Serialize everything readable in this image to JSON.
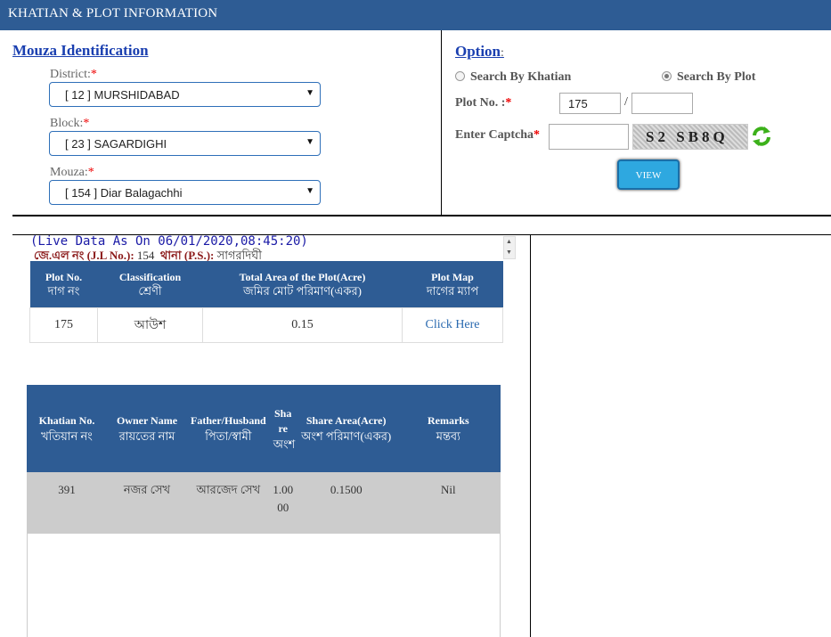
{
  "header": {
    "title": "KHATIAN & PLOT INFORMATION"
  },
  "mouza": {
    "title": "Mouza Identification",
    "district_label": "District:",
    "district_value": "[ 12 ] MURSHIDABAD",
    "block_label": "Block:",
    "block_value": "[ 23 ] SAGARDIGHI",
    "mouza_label": "Mouza:",
    "mouza_value": "[ 154 ] Diar Balagachhi",
    "required_mark": "*"
  },
  "option": {
    "title": "Option",
    "title_suffix": ":",
    "radio_khatian": "Search By Khatian",
    "radio_plot": "Search By Plot",
    "plot_label": "Plot No. :",
    "plot_value": "175",
    "plot_separator": "/",
    "plot_sub_value": "",
    "captcha_label": "Enter Captcha",
    "captcha_value": "",
    "captcha_text": "S2 SB8Q",
    "view_label": "VIEW"
  },
  "result": {
    "live_data": "(Live Data As On 06/01/2020,08:45:20)",
    "jl_label": "জে.এল নং (J.L No.):",
    "jl_value": "154",
    "ps_label": "থানা (P.S.):",
    "ps_value": "সাগরদিঘী"
  },
  "plot_table": {
    "headers": [
      {
        "en": "Plot No.",
        "bn": "দাগ নং"
      },
      {
        "en": "Classification",
        "bn": "শ্রেণী"
      },
      {
        "en": "Total Area of the Plot(Acre)",
        "bn": "জমির মোট পরিমাণ(একর)"
      },
      {
        "en": "Plot Map",
        "bn": "দাগের ম্যাপ"
      }
    ],
    "row": {
      "plot_no": "175",
      "classification": "আউশ",
      "area": "0.15",
      "map_link": "Click Here"
    }
  },
  "owner_table": {
    "headers": [
      {
        "en": "Khatian No.",
        "bn": "খতিয়ান নং"
      },
      {
        "en": "Owner Name",
        "bn": "রায়তের নাম"
      },
      {
        "en": "Father/Husband",
        "bn": "পিতা/স্বামী"
      },
      {
        "en": "Share",
        "bn": "অংশ"
      },
      {
        "en": "Share Area(Acre)",
        "bn": "অংশ পরিমাণ(একর)"
      },
      {
        "en": "Remarks",
        "bn": "মন্তব্য"
      }
    ],
    "row": {
      "khatian_no": "391",
      "owner_name": "নজর সেখ",
      "father": "আরজেদ সেখ",
      "share": "1.0000",
      "share_area": "0.1500",
      "remarks": "Nil"
    }
  },
  "colors": {
    "header_bg": "#2e5c94",
    "view_button": "#2ea8e0",
    "required": "#e00000"
  },
  "icons": [
    "refresh-icon",
    "dropdown-arrow-icon",
    "scroll-up-icon",
    "scroll-down-icon"
  ]
}
